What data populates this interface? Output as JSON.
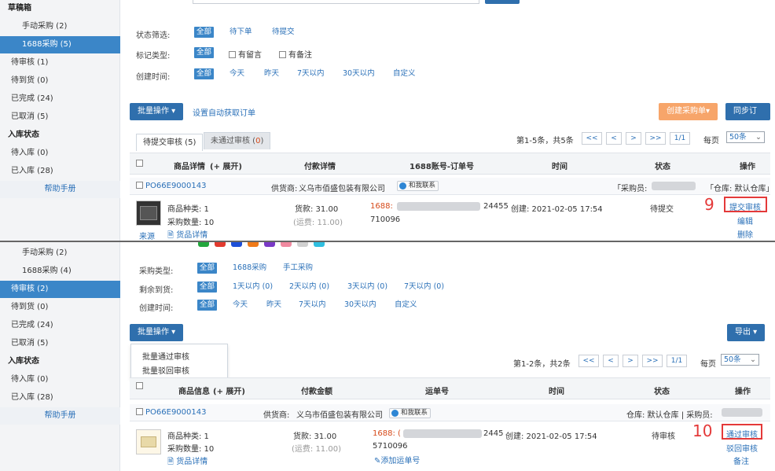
{
  "colors": {
    "accent": "#3b86c8",
    "button": "#2f6fad",
    "orange": "#f7a56a",
    "callout": "#e43939",
    "link": "#2a70b8"
  },
  "top": {
    "sidebar": [
      {
        "label": "草稿箱",
        "type": "hdr"
      },
      {
        "label": "手动采购 (2)",
        "type": "ind"
      },
      {
        "label": "1688采购 (5)",
        "type": "ind",
        "active": true
      },
      {
        "label": "待审核 (1)",
        "type": "top"
      },
      {
        "label": "待到货 (0)",
        "type": "top"
      },
      {
        "label": "已完成 (24)",
        "type": "top"
      },
      {
        "label": "已取消 (5)",
        "type": "top"
      },
      {
        "label": "入库状态",
        "type": "hdr"
      },
      {
        "label": "待入库 (0)",
        "type": "top"
      },
      {
        "label": "已入库 (28)",
        "type": "top"
      },
      {
        "label": "帮助手册",
        "type": "help"
      }
    ],
    "filters": {
      "status_label": "状态筛选:",
      "status_options": [
        "全部",
        "待下单",
        "待提交"
      ],
      "mark_label": "标记类型:",
      "mark_all": "全部",
      "mark_checks": [
        "有留言",
        "有备注"
      ],
      "time_label": "创建时间:",
      "time_options": [
        "全部",
        "今天",
        "昨天",
        "7天以内",
        "30天以内",
        "自定义"
      ]
    },
    "toolbar": {
      "batch": "批量操作 ▾",
      "auto_fetch": "设置自动获取订单",
      "create": "创建采购单▾",
      "sync": "同步订单"
    },
    "tabs": {
      "active": "待提交审核 (5)",
      "inactive_prefix": "未通过审核 (",
      "inactive_count": "0",
      "inactive_suffix": ")"
    },
    "pager": {
      "summary": "第1-5条，共5条",
      "first": "<<",
      "prev": "<",
      "next": ">",
      "last": ">>",
      "page": "1/1",
      "per_label": "每页",
      "per_value": "50条"
    },
    "table_headers": {
      "product": "商品详情",
      "expand": "(+ 展开)",
      "payment": "付款详情",
      "account": "1688账号-订单号",
      "time": "时间",
      "status": "状态",
      "ops": "操作"
    },
    "order": {
      "po": "PO66E9000143",
      "supplier_label": "供货商:",
      "supplier": "义乌市佰盛包装有限公司",
      "contact": "和我联系",
      "buyer_label": "「采购员:",
      "warehouse": "「仓库: 默认仓库」",
      "kinds": "商品种类: 1",
      "qty": "采购数量: 10",
      "source": "来源",
      "detail": "货品详情",
      "goods": "货款: 31.00",
      "freight": "(运费: 11.00)",
      "account_prefix": "1688:",
      "order_tail": "24455",
      "order_line2": "710096",
      "created": "创建: 2021-02-05 17:54",
      "status": "待提交",
      "ops": [
        "提交审核",
        "编辑",
        "删除"
      ],
      "step": "9"
    }
  },
  "bottom": {
    "sidebar": [
      {
        "label": "手动采购 (2)",
        "type": "ind"
      },
      {
        "label": "1688采购 (4)",
        "type": "ind"
      },
      {
        "label": "待审核 (2)",
        "type": "top",
        "active": true
      },
      {
        "label": "待到货 (0)",
        "type": "top"
      },
      {
        "label": "已完成 (24)",
        "type": "top"
      },
      {
        "label": "已取消 (5)",
        "type": "top"
      },
      {
        "label": "入库状态",
        "type": "hdr"
      },
      {
        "label": "待入库 (0)",
        "type": "top"
      },
      {
        "label": "已入库 (28)",
        "type": "top"
      },
      {
        "label": "帮助手册",
        "type": "help"
      }
    ],
    "swatches": [
      "#22a63c",
      "#e23a2e",
      "#1d4fd8",
      "#f07a18",
      "#7a39c6",
      "#f08aa0",
      "#d0d0d0",
      "#2fbfe0"
    ],
    "filters": {
      "type_label": "采购类型:",
      "type_options": [
        "全部",
        "1688采购",
        "手工采购"
      ],
      "arrival_label": "剩余到货:",
      "arrival_options": [
        "全部",
        "1天以内 (0)",
        "2天以内 (0)",
        "3天以内 (0)",
        "7天以内 (0)"
      ],
      "time_label": "创建时间:",
      "time_options": [
        "全部",
        "今天",
        "昨天",
        "7天以内",
        "30天以内",
        "自定义"
      ]
    },
    "toolbar": {
      "batch": "批量操作 ▾",
      "export": "导出 ▾"
    },
    "dropdown": [
      "批量通过审核",
      "批量驳回审核"
    ],
    "pager": {
      "summary": "第1-2条，共2条",
      "first": "<<",
      "prev": "<",
      "next": ">",
      "last": ">>",
      "page": "1/1",
      "per_label": "每页",
      "per_value": "50条"
    },
    "table_headers": {
      "product": "商品信息",
      "expand": "(+ 展开)",
      "payment": "付款金额",
      "tracking": "运单号",
      "time": "时间",
      "status": "状态",
      "ops": "操作"
    },
    "order": {
      "po": "PO66E9000143",
      "supplier_label": "供货商:",
      "supplier": "义乌市佰盛包装有限公司",
      "contact": "和我联系",
      "warehouse_buyer": "仓库: 默认仓库 | 采购员:",
      "kinds": "商品种类: 1",
      "qty": "采购数量: 10",
      "detail": "货品详情",
      "goods": "货款: 31.00",
      "freight": "(运费: 11.00)",
      "account_prefix": "1688: (",
      "order_tail": "2445",
      "order_line2": "5710096",
      "add_tracking": "添加运单号",
      "created": "创建: 2021-02-05 17:54",
      "status": "待审核",
      "ops": [
        "通过审核",
        "驳回审核",
        "备注"
      ],
      "step": "10"
    }
  }
}
